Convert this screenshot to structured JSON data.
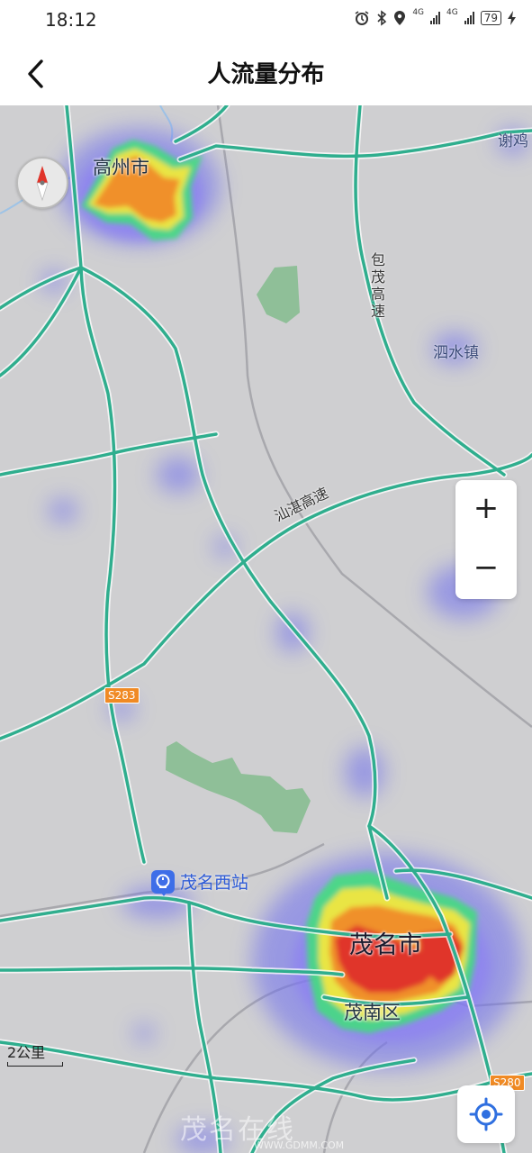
{
  "status_bar": {
    "time": "18:12",
    "net1": "4G",
    "net2": "4G",
    "battery": "79",
    "icons": [
      "alarm-icon",
      "bluetooth-icon",
      "location-icon",
      "signal-icon",
      "signal-icon",
      "battery-icon",
      "charging-icon"
    ]
  },
  "header": {
    "title": "人流量分布",
    "back_icon": "chevron-left-icon"
  },
  "map": {
    "places": {
      "maoming": "茂名市",
      "gaozhou": "高州市",
      "maonan": "茂南区",
      "sishui": "泗水镇",
      "xieji": "谢鸡",
      "station": "茂名西站"
    },
    "roads": {
      "baomao": "包茂高速",
      "shanzhan": "汕湛高速"
    },
    "shields": {
      "s283": "S283",
      "s280": "S280"
    },
    "scale": "2公里",
    "watermark": "茂名在线",
    "watermark_url": "WWW.GDMM.COM",
    "colors": {
      "background": "#cfcfd1",
      "expressway": "#2fae8e",
      "heat_low": "#6c6cf0",
      "heat_mid": "#3fe07a",
      "heat_high": "#f2e640",
      "heat_peak": "#e0342a",
      "green_area": "#8fbf98"
    }
  },
  "controls": {
    "zoom_in": "+",
    "zoom_out": "−",
    "compass_icon": "compass-icon",
    "locate_icon": "locate-icon"
  }
}
